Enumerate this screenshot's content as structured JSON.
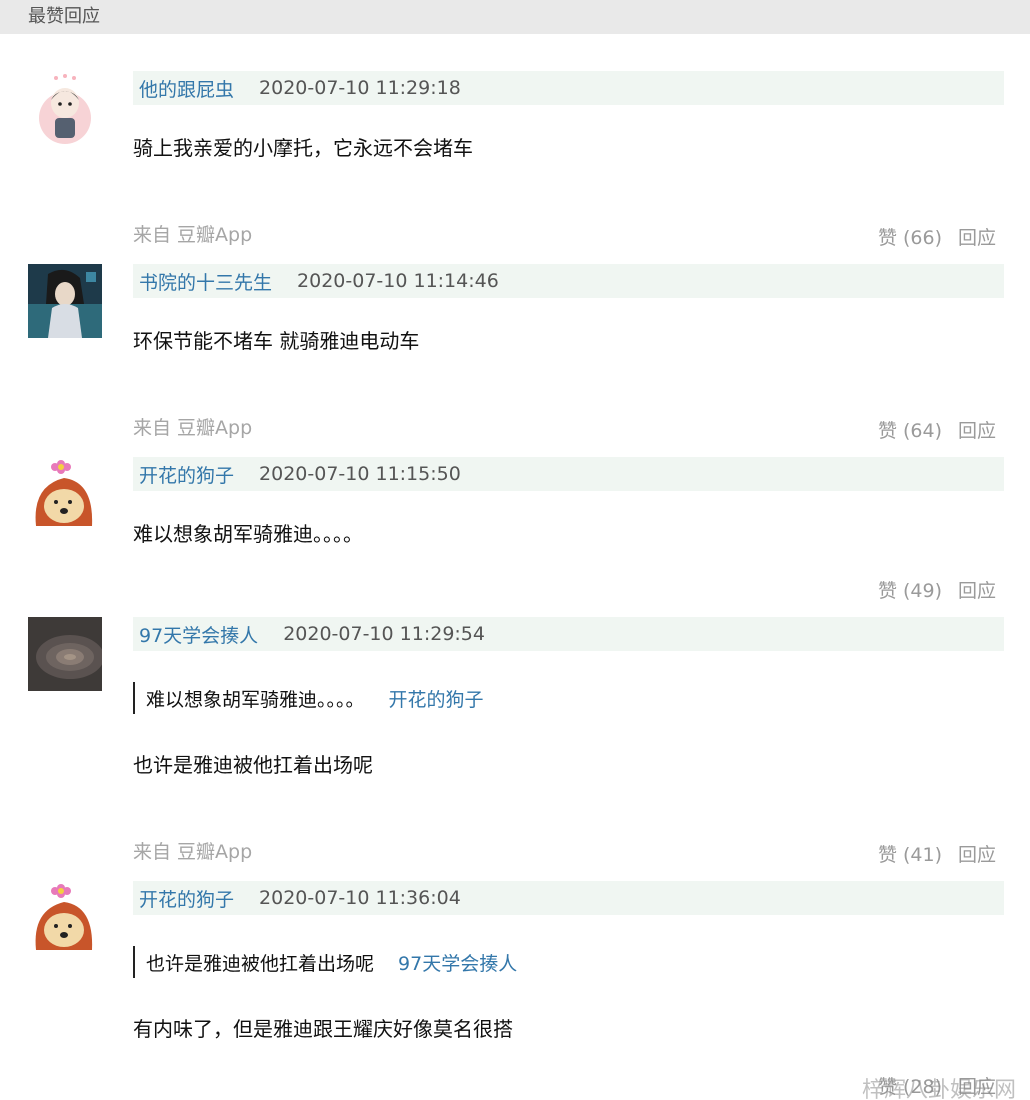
{
  "header": {
    "title": "最赞回应"
  },
  "comments": [
    {
      "author": "他的跟屁虫",
      "time": "2020-07-10 11:29:18",
      "text": "骑上我亲爱的小摩托，它永远不会堵车",
      "source_prefix": "来自",
      "source_app": "豆瓣App",
      "like_label": "赞 (66)",
      "reply_label": "回应"
    },
    {
      "author": "书院的十三先生",
      "time": "2020-07-10 11:14:46",
      "text": "环保节能不堵车 就骑雅迪电动车",
      "source_prefix": "来自",
      "source_app": "豆瓣App",
      "like_label": "赞 (64)",
      "reply_label": "回应"
    },
    {
      "author": "开花的狗子",
      "time": "2020-07-10 11:15:50",
      "text": "难以想象胡军骑雅迪。。。。",
      "like_label": "赞 (49)",
      "reply_label": "回应"
    },
    {
      "author": "97天学会揍人",
      "time": "2020-07-10 11:29:54",
      "quote_text": "难以想象胡军骑雅迪。。。。",
      "quote_author": "开花的狗子",
      "text": "也许是雅迪被他扛着出场呢",
      "source_prefix": "来自",
      "source_app": "豆瓣App",
      "like_label": "赞 (41)",
      "reply_label": "回应"
    },
    {
      "author": "开花的狗子",
      "time": "2020-07-10 11:36:04",
      "quote_text": "也许是雅迪被他扛着出场呢",
      "quote_author": "97天学会揍人",
      "text": "有内味了，但是雅迪跟王耀庆好像莫名很搭",
      "like_label": "赞 (28)",
      "reply_label": "回应"
    }
  ],
  "watermark": "梓辉八卦娱乐网"
}
